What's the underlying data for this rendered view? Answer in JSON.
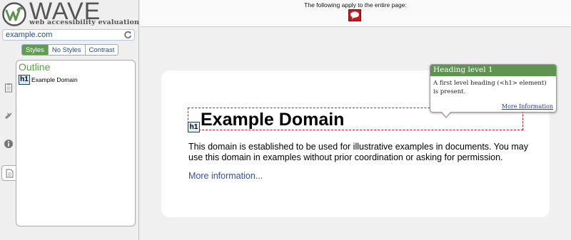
{
  "app": {
    "logo_text": "WAVE",
    "tagline": "web accessibility evaluation tool"
  },
  "sidebar": {
    "url": "example.com",
    "view_tabs": [
      "Styles",
      "No Styles",
      "Contrast"
    ],
    "active_view_tab": "Styles",
    "icons": [
      "clipboard-icon",
      "bird-icon",
      "info-icon",
      "document-icon"
    ],
    "outline": {
      "title": "Outline",
      "items": [
        {
          "badge": "h1",
          "label": "Example Domain"
        }
      ]
    }
  },
  "topbar": {
    "apply_text": "The following apply to the entire page:",
    "page_icon": "speech-bubble-icon"
  },
  "page": {
    "heading_badge": "h1",
    "heading": "Example Domain",
    "paragraph": "This domain is established to be used for illustrative examples in documents. You may use this domain in examples without prior coordination or asking for permission.",
    "link": "More information..."
  },
  "tooltip": {
    "title": "Heading level 1",
    "body": "A first level heading (<h1> element) is present.",
    "more_link": "More Information"
  },
  "colors": {
    "brand_green": "#5e9350",
    "error_red": "#c9161c",
    "link_blue": "#384f9b"
  }
}
